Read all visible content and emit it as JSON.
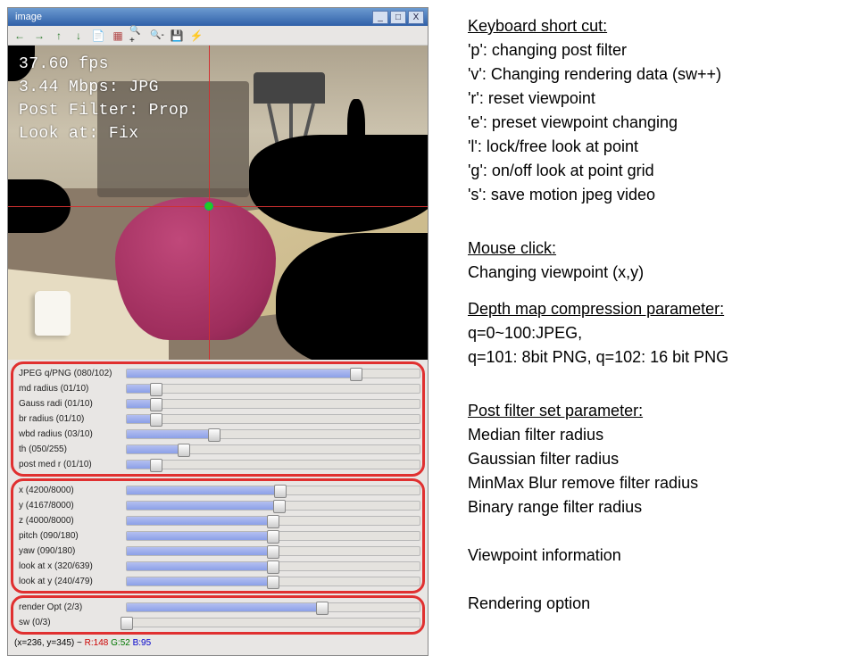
{
  "window": {
    "title": "image",
    "controls": {
      "minimize": "_",
      "maximize": "□",
      "close": "X"
    },
    "toolbar_icons": [
      "arrow-left",
      "arrow-right",
      "arrow-up",
      "arrow-down",
      "file",
      "screenshot",
      "zoom-in",
      "zoom-out",
      "save",
      "flash"
    ]
  },
  "overlay": {
    "fps": "37.60 fps",
    "bitrate": "3.44 Mbps: JPG",
    "post_filter": "Post Filter: Prop",
    "look_at": "Look at: Fix"
  },
  "sliders": {
    "group1": [
      {
        "label": "JPEG q/PNG",
        "value": 80,
        "max": 102,
        "display": "(080/102)"
      },
      {
        "label": "md radius",
        "value": 1,
        "max": 10,
        "display": "(01/10)"
      },
      {
        "label": "Gauss radi",
        "value": 1,
        "max": 10,
        "display": "(01/10)"
      },
      {
        "label": "br radius",
        "value": 1,
        "max": 10,
        "display": "(01/10)"
      },
      {
        "label": "wbd radius",
        "value": 3,
        "max": 10,
        "display": "(03/10)"
      },
      {
        "label": "th",
        "value": 50,
        "max": 255,
        "display": "(050/255)"
      },
      {
        "label": "post med r",
        "value": 1,
        "max": 10,
        "display": "(01/10)"
      }
    ],
    "group2": [
      {
        "label": "x",
        "value": 4200,
        "max": 8000,
        "display": "(4200/8000)"
      },
      {
        "label": "y",
        "value": 4167,
        "max": 8000,
        "display": "(4167/8000)"
      },
      {
        "label": "z",
        "value": 4000,
        "max": 8000,
        "display": "(4000/8000)"
      },
      {
        "label": "pitch",
        "value": 90,
        "max": 180,
        "display": "(090/180)"
      },
      {
        "label": "yaw",
        "value": 90,
        "max": 180,
        "display": "(090/180)"
      },
      {
        "label": "look at x",
        "value": 320,
        "max": 639,
        "display": "(320/639)"
      },
      {
        "label": "look at y",
        "value": 240,
        "max": 479,
        "display": "(240/479)"
      }
    ],
    "group3": [
      {
        "label": "render Opt",
        "value": 2,
        "max": 3,
        "display": "(2/3)"
      },
      {
        "label": "sw",
        "value": 0,
        "max": 3,
        "display": "(0/3)"
      }
    ]
  },
  "status_line": {
    "prefix": "(x=236, y=345) ~",
    "r": "R:148",
    "g": "G:52",
    "b": "B:95"
  },
  "right": {
    "keyboard_hdr": "Keyboard short cut:",
    "shortcuts": [
      "'p': changing post filter",
      "'v': Changing rendering data (sw++)",
      "'r': reset viewpoint",
      "'e': preset viewpoint changing",
      "'l': lock/free look at point",
      "'g':  on/off look at point grid",
      "'s': save motion jpeg video"
    ],
    "mouse_hdr": "Mouse click:",
    "mouse_line": "Changing viewpoint (x,y)",
    "depth_hdr": "Depth map compression parameter:",
    "depth_l1": "q=0~100:JPEG,",
    "depth_l2": "q=101: 8bit PNG, q=102: 16 bit PNG",
    "post_hdr": "Post filter set parameter:",
    "post_items": [
      "Median filter radius",
      "Gaussian filter radius",
      "MinMax Blur remove filter radius",
      "Binary range filter radius"
    ],
    "viewpoint": "Viewpoint information",
    "rendering": "Rendering option"
  },
  "icon_glyphs": {
    "arrow-left": "←",
    "arrow-right": "→",
    "arrow-up": "↑",
    "arrow-down": "↓",
    "file": "📄",
    "screenshot": "▦",
    "zoom-in": "🔍+",
    "zoom-out": "🔍-",
    "save": "💾",
    "flash": "⚡"
  }
}
